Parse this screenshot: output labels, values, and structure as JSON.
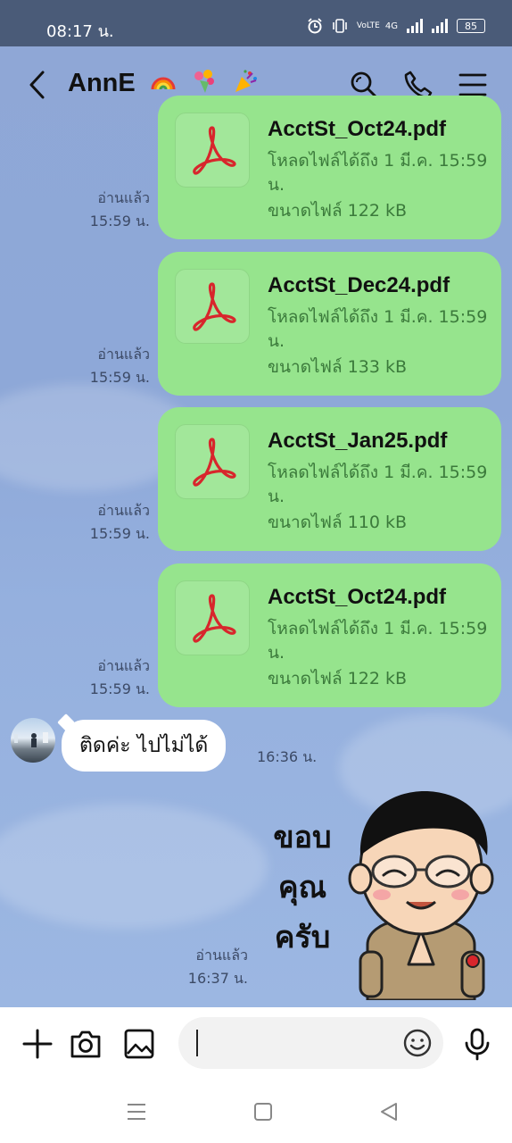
{
  "status_bar": {
    "time": "08:17 น.",
    "network": "VoLTE",
    "signal": "4G",
    "battery": "85"
  },
  "header": {
    "title": "AnnE"
  },
  "messages": [
    {
      "file_name": "AcctSt_Oct24.pdf",
      "download_until": "โหลดไฟล์ได้ถึง 1 มี.ค. 15:59 น.",
      "size": "ขนาดไฟล์ 122 kB",
      "read": "อ่านแล้ว",
      "time": "15:59 น."
    },
    {
      "file_name": "AcctSt_Dec24.pdf",
      "download_until": "โหลดไฟล์ได้ถึง 1 มี.ค. 15:59 น.",
      "size": "ขนาดไฟล์ 133 kB",
      "read": "อ่านแล้ว",
      "time": "15:59 น."
    },
    {
      "file_name": "AcctSt_Jan25.pdf",
      "download_until": "โหลดไฟล์ได้ถึง 1 มี.ค. 15:59 น.",
      "size": "ขนาดไฟล์ 110 kB",
      "read": "อ่านแล้ว",
      "time": "15:59 น."
    },
    {
      "file_name": "AcctSt_Oct24.pdf",
      "download_until": "โหลดไฟล์ได้ถึง 1 มี.ค. 15:59 น.",
      "size": "ขนาดไฟล์ 122 kB",
      "read": "อ่านแล้ว",
      "time": "15:59 น."
    }
  ],
  "incoming": {
    "text": "ติดค่ะ ไปไม่ได้",
    "time": "16:36 น."
  },
  "sticker": {
    "text": "ขอบ คุณ ครับ",
    "read": "อ่านแล้ว",
    "time": "16:37 น."
  },
  "colors": {
    "bubble_green": "#96e48d",
    "pdf_red": "#d8262c",
    "status_bar": "#4a5b78"
  },
  "icons": [
    "back-arrow-icon",
    "search-icon",
    "phone-icon",
    "menu-icon",
    "plus-icon",
    "camera-icon",
    "image-icon",
    "emoji-icon",
    "mic-icon",
    "pdf-icon"
  ]
}
